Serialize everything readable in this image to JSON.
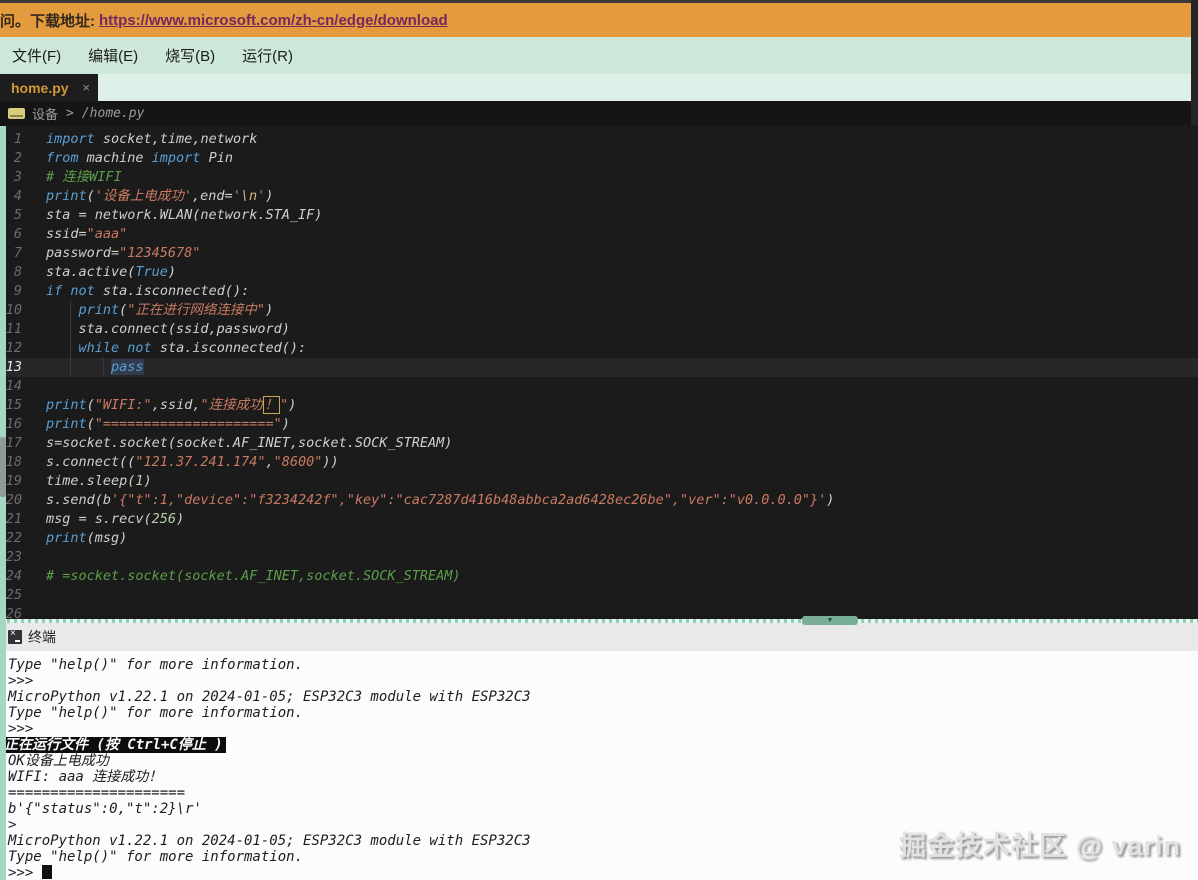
{
  "banner": {
    "prefix": "问。下载地址:",
    "link": "https://www.microsoft.com/zh-cn/edge/download"
  },
  "menu": {
    "items": [
      {
        "label": "文件(F)"
      },
      {
        "label": "编辑(E)"
      },
      {
        "label": "烧写(B)"
      },
      {
        "label": "运行(R)"
      }
    ]
  },
  "tab": {
    "label": "home.py",
    "close": "×"
  },
  "breadcrumb": {
    "device": "设备",
    "separator": ">",
    "path": "/home.py"
  },
  "editor": {
    "current_line": 13,
    "lines": [
      {
        "n": 1,
        "seg": [
          [
            "kw",
            "import"
          ],
          [
            "pl",
            " socket,time,network"
          ]
        ]
      },
      {
        "n": 2,
        "seg": [
          [
            "kw",
            "from"
          ],
          [
            "pl",
            " machine "
          ],
          [
            "kw",
            "import"
          ],
          [
            "pl",
            " Pin"
          ]
        ]
      },
      {
        "n": 3,
        "seg": [
          [
            "com",
            "# 连接WIFI"
          ]
        ]
      },
      {
        "n": 4,
        "seg": [
          [
            "kw",
            "print"
          ],
          [
            "pl",
            "("
          ],
          [
            "str",
            "'设备上电成功'"
          ],
          [
            "pl",
            ",end="
          ],
          [
            "str",
            "'"
          ],
          [
            "esc",
            "\\n"
          ],
          [
            "str",
            "'"
          ],
          [
            "pl",
            ")"
          ]
        ]
      },
      {
        "n": 5,
        "seg": [
          [
            "pl",
            "sta = network.WLAN(network.STA_IF)"
          ]
        ]
      },
      {
        "n": 6,
        "seg": [
          [
            "pl",
            "ssid="
          ],
          [
            "str",
            "\"aaa\""
          ]
        ]
      },
      {
        "n": 7,
        "seg": [
          [
            "pl",
            "password="
          ],
          [
            "str",
            "\"12345678\""
          ]
        ]
      },
      {
        "n": 8,
        "seg": [
          [
            "pl",
            "sta.active("
          ],
          [
            "kw",
            "True"
          ],
          [
            "pl",
            ")"
          ]
        ]
      },
      {
        "n": 9,
        "seg": [
          [
            "kw",
            "if"
          ],
          [
            "pl",
            " "
          ],
          [
            "kw",
            "not"
          ],
          [
            "pl",
            " sta.isconnected():"
          ]
        ]
      },
      {
        "n": 10,
        "seg": [
          [
            "pl",
            "    "
          ],
          [
            "kw",
            "print"
          ],
          [
            "pl",
            "("
          ],
          [
            "str",
            "\"正在进行网络连接中\""
          ],
          [
            "pl",
            ")"
          ]
        ]
      },
      {
        "n": 11,
        "seg": [
          [
            "pl",
            "    sta.connect(ssid,password)"
          ]
        ]
      },
      {
        "n": 12,
        "seg": [
          [
            "pl",
            "    "
          ],
          [
            "kw",
            "while"
          ],
          [
            "pl",
            " "
          ],
          [
            "kw",
            "not"
          ],
          [
            "pl",
            " sta.isconnected():"
          ]
        ]
      },
      {
        "n": 13,
        "seg": [
          [
            "pl",
            "        "
          ],
          [
            "cur",
            "pass"
          ]
        ]
      },
      {
        "n": 14,
        "seg": []
      },
      {
        "n": 15,
        "seg": [
          [
            "kw",
            "print"
          ],
          [
            "pl",
            "("
          ],
          [
            "str",
            "\"WIFI:\""
          ],
          [
            "pl",
            ",ssid,"
          ],
          [
            "str",
            "\"连接成功"
          ],
          [
            "boxed",
            "！"
          ],
          [
            "str",
            "\""
          ],
          [
            "pl",
            ")"
          ]
        ]
      },
      {
        "n": 16,
        "seg": [
          [
            "kw",
            "print"
          ],
          [
            "pl",
            "("
          ],
          [
            "str",
            "\"=====================\""
          ],
          [
            "pl",
            ")"
          ]
        ]
      },
      {
        "n": 17,
        "seg": [
          [
            "pl",
            "s=socket.socket(socket.AF_INET,socket.SOCK_STREAM)"
          ]
        ]
      },
      {
        "n": 18,
        "seg": [
          [
            "pl",
            "s.connect(("
          ],
          [
            "str",
            "\"121.37.241.174\""
          ],
          [
            "pl",
            ","
          ],
          [
            "str",
            "\"8600\""
          ],
          [
            "pl",
            "))"
          ]
        ]
      },
      {
        "n": 19,
        "seg": [
          [
            "pl",
            "time.sleep("
          ],
          [
            "num",
            "1"
          ],
          [
            "pl",
            ")"
          ]
        ]
      },
      {
        "n": 20,
        "seg": [
          [
            "pl",
            "s.send(b"
          ],
          [
            "str",
            "'{\"t\":1,\"device\":\"f3234242f\",\"key\":\"cac7287d416b48abbca2ad6428ec26be\",\"ver\":\"v0.0.0.0\"}'"
          ],
          [
            "pl",
            ")"
          ]
        ]
      },
      {
        "n": 21,
        "seg": [
          [
            "pl",
            "msg = s.recv("
          ],
          [
            "num",
            "256"
          ],
          [
            "pl",
            ")"
          ]
        ]
      },
      {
        "n": 22,
        "seg": [
          [
            "kw",
            "print"
          ],
          [
            "pl",
            "(msg)"
          ]
        ]
      },
      {
        "n": 23,
        "seg": []
      },
      {
        "n": 24,
        "seg": [
          [
            "com",
            "# =socket.socket(socket.AF_INET,socket.SOCK_STREAM)"
          ]
        ]
      },
      {
        "n": 25,
        "seg": []
      },
      {
        "n": 26,
        "seg": []
      }
    ]
  },
  "terminal": {
    "title": "终端",
    "lines": [
      {
        "style": "plain",
        "text": "Type \"help()\" for more information."
      },
      {
        "style": "plain",
        "text": ">>>"
      },
      {
        "style": "plain",
        "text": "MicroPython v1.22.1 on 2024-01-05; ESP32C3 module with ESP32C3"
      },
      {
        "style": "plain",
        "text": "Type \"help()\" for more information."
      },
      {
        "style": "plain",
        "text": ">>>"
      },
      {
        "style": "inverted",
        "text": "正在运行文件 (按 Ctrl+C停止 )"
      },
      {
        "style": "plain",
        "text": "OK设备上电成功"
      },
      {
        "style": "plain",
        "text": "WIFI: aaa 连接成功！"
      },
      {
        "style": "plain",
        "text": "====================="
      },
      {
        "style": "plain",
        "text": "b'{\"status\":0,\"t\":2}\\r'"
      },
      {
        "style": "plain",
        "text": ">"
      },
      {
        "style": "plain",
        "text": "MicroPython v1.22.1 on 2024-01-05; ESP32C3 module with ESP32C3"
      },
      {
        "style": "plain",
        "text": "Type \"help()\" for more information."
      },
      {
        "style": "cursor",
        "text": ">>> "
      }
    ]
  },
  "watermark": {
    "text": "掘金技术社区 @ varin"
  },
  "colors": {
    "banner_bg": "#e49b3d",
    "menu_bg": "#cde7d9",
    "tabstrip_bg": "#dcf0e8",
    "editor_bg": "#1b1b1c",
    "keyword": "#5a9fd4",
    "string": "#c97a60",
    "comment": "#5c9e49",
    "tab_label": "#cf9937",
    "left_strip": "#a6d7c0",
    "terminal_bg": "#fcfcfc"
  }
}
